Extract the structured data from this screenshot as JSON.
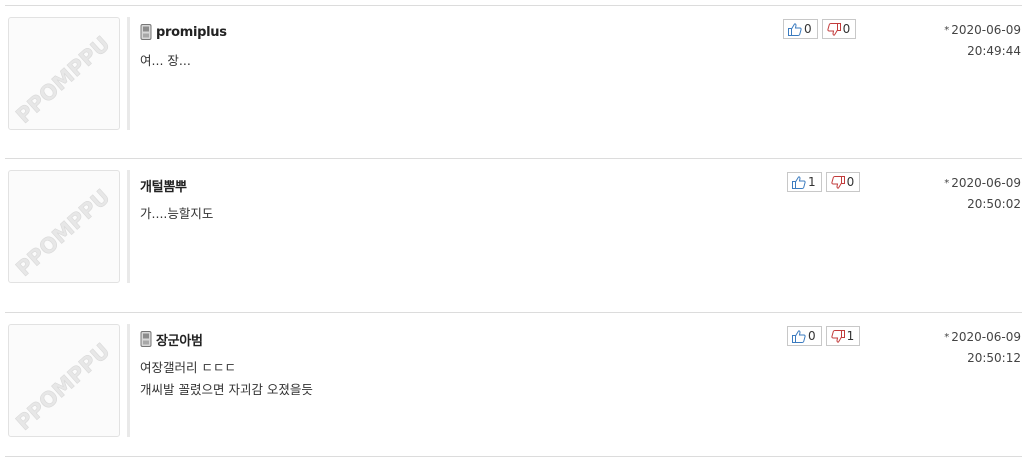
{
  "comments": [
    {
      "author": "promiplus",
      "mobile": true,
      "lines": [
        "여... 장..."
      ],
      "likes": "0",
      "dislikes": "0",
      "date": "2020-06-09",
      "time": "20:49:44"
    },
    {
      "author": "개털뽐뿌",
      "mobile": false,
      "lines": [
        "가....능할지도"
      ],
      "likes": "1",
      "dislikes": "0",
      "date": "2020-06-09",
      "time": "20:50:02"
    },
    {
      "author": "장군아범",
      "mobile": true,
      "lines": [
        "여장갤러리 ㄷㄷㄷ",
        "개씨발 꼴렸으면 자괴감 오졌을듯"
      ],
      "likes": "0",
      "dislikes": "1",
      "date": "2020-06-09",
      "time": "20:50:12"
    }
  ],
  "avatar_watermark": "PPOMPPU",
  "meta_bullet": "*"
}
